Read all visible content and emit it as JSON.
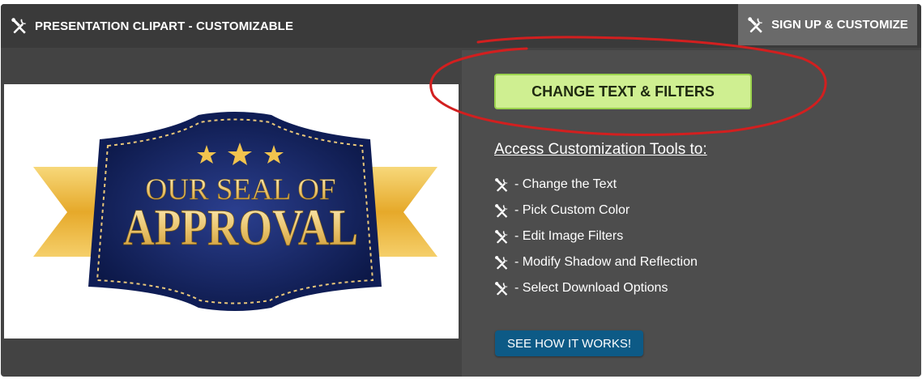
{
  "header": {
    "title": "PRESENTATION CLIPART - CUSTOMIZABLE",
    "signup_label": "SIGN UP & CUSTOMIZE"
  },
  "image": {
    "line1": "OUR SEAL OF",
    "line2": "APPROVAL"
  },
  "customize": {
    "cta_label": "CHANGE TEXT & FILTERS",
    "access_heading": "Access Customization Tools to:",
    "features": [
      "- Change the Text",
      "- Pick Custom Color",
      "- Edit Image Filters",
      "- Modify Shadow and Reflection",
      "- Select Download Options"
    ],
    "how_it_works_label": "SEE HOW IT WORKS!"
  },
  "icons": {
    "tools": "tools-icon"
  },
  "colors": {
    "panel_bg": "#434343",
    "cta_bg": "#cfef91",
    "how_btn_bg": "#0d5a86",
    "annotation_red": "#d21f1f",
    "seal_navy": "#132560",
    "ribbon_gold": "#e8b23a"
  }
}
